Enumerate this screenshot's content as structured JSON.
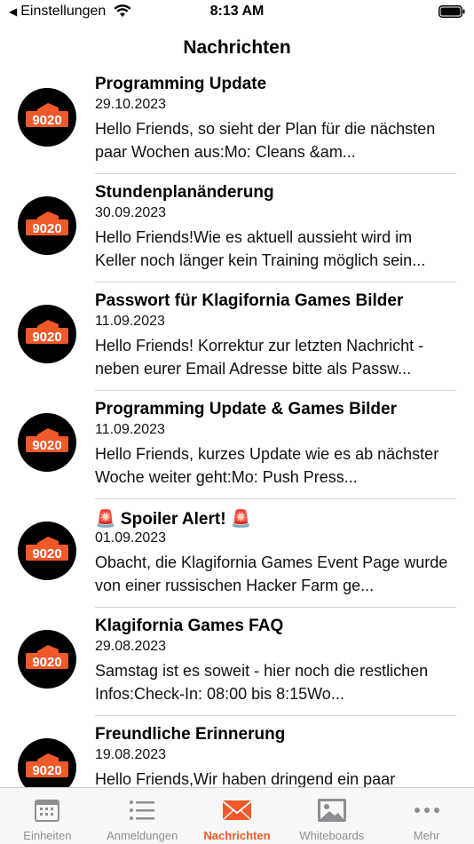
{
  "status_bar": {
    "back_app": "Einstellungen",
    "time": "8:13 AM"
  },
  "nav": {
    "title": "Nachrichten"
  },
  "avatar_text": "9020",
  "messages": [
    {
      "title": "Programming Update",
      "date": "29.10.2023",
      "body": "Hello Friends, so sieht der Plan für die nächsten paar Wochen aus:Mo: Cleans &am..."
    },
    {
      "title": "Stundenplanänderung",
      "date": "30.09.2023",
      "body": "Hello Friends!Wie es aktuell aussieht wird im Keller noch länger kein Training möglich sein..."
    },
    {
      "title": "Passwort für Klagifornia Games Bilder",
      "date": "11.09.2023",
      "body": "Hello Friends! Korrektur zur letzten Nachricht - neben eurer Email Adresse bitte als Passw..."
    },
    {
      "title": "Programming Update & Games Bilder",
      "date": "11.09.2023",
      "body": "Hello Friends, kurzes Update wie es ab nächster Woche weiter geht:Mo: Push Press..."
    },
    {
      "title": "🚨 Spoiler Alert! 🚨",
      "date": "01.09.2023",
      "body": "Obacht, die Klagifornia Games Event Page wurde von einer russischen Hacker Farm ge..."
    },
    {
      "title": "Klagifornia Games FAQ",
      "date": "29.08.2023",
      "body": "Samstag ist es soweit - hier noch die restlichen Infos:Check-In: 08:00 bis 8:15Wo..."
    },
    {
      "title": "Freundliche Erinnerung",
      "date": "19.08.2023",
      "body": "Hello Friends,Wir haben dringend ein paar"
    }
  ],
  "tabs": [
    {
      "label": "Einheiten",
      "icon": "calendar-icon"
    },
    {
      "label": "Anmeldungen",
      "icon": "list-icon"
    },
    {
      "label": "Nachrichten",
      "icon": "envelope-icon"
    },
    {
      "label": "Whiteboards",
      "icon": "photo-icon"
    },
    {
      "label": "Mehr",
      "icon": "more-icon"
    }
  ],
  "colors": {
    "accent": "#f0592a",
    "inactive": "#8e8e93",
    "avatar_bg": "#000000",
    "avatar_accent": "#f0592a"
  }
}
